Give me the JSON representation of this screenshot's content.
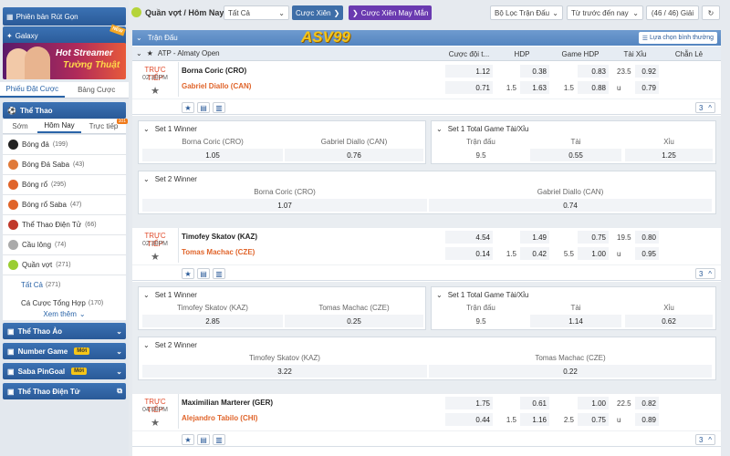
{
  "sidebar": {
    "top_button": "Phiên bản Rút Gọn",
    "galaxy": "Galaxy",
    "new_tag": "NEW",
    "banner_line1": "Hot Streamer",
    "banner_line2": "Tường Thuật",
    "tabs": [
      "Phiếu Đặt Cược",
      "Bảng Cược"
    ],
    "sports_header": "Thể Thao",
    "sub_tabs": [
      "Sớm",
      "Hôm Nay",
      "Trực tiếp"
    ],
    "live_badge": "101",
    "sports": [
      {
        "name": "Bóng đá",
        "count": "(199)",
        "color": "#222"
      },
      {
        "name": "Bóng Đá Saba",
        "count": "(43)",
        "color": "#e07a3a"
      },
      {
        "name": "Bóng rổ",
        "count": "(295)",
        "color": "#e0642a"
      },
      {
        "name": "Bóng rổ Saba",
        "count": "(47)",
        "color": "#e0642a"
      },
      {
        "name": "Thể Thao Điện Tử",
        "count": "(66)",
        "color": "#c0392b"
      },
      {
        "name": "Cầu lông",
        "count": "(74)",
        "color": "#888"
      },
      {
        "name": "Quần vợt",
        "count": "(271)",
        "color": "#9acd32"
      }
    ],
    "tennis_sub": [
      {
        "name": "Tất Cả",
        "count": "(271)"
      },
      {
        "name": "Cá Cược Tổng Hợp",
        "count": "(170)"
      }
    ],
    "see_more": "Xem thêm",
    "sections": [
      {
        "label": "Thể Thao Ảo",
        "tag": ""
      },
      {
        "label": "Number Game",
        "tag": "Mới"
      },
      {
        "label": "Saba PinGoal",
        "tag": "Mới"
      },
      {
        "label": "Thể Thao Điện Tử",
        "tag": ""
      }
    ]
  },
  "topbar": {
    "breadcrumb": "Quần vợt / Hôm Nay",
    "filter_all": "Tất Cả",
    "parlay": "Cược Xiên",
    "lucky_parlay": "Cược Xiên May Mắn",
    "match_filter": "Bộ Lọc Trận Đấu",
    "time_filter": "Từ trước đến nay",
    "count": "(46 / 46) Giải"
  },
  "main": {
    "section_title": "Trận Đấu",
    "logo_text": "ASV99",
    "sort": "Lựa chọn bình thường",
    "league": "ATP - Almaty Open",
    "columns": [
      "Cược đội t...",
      "HDP",
      "Game HDP",
      "Tài Xỉu",
      "Chẵn Lẻ"
    ]
  },
  "matches": [
    {
      "live": "TRỰC TIẾP",
      "time": "02:30PM",
      "team_a": "Borna Coric (CRO)",
      "team_b": "Gabriel Diallo (CAN)",
      "row1": {
        "ml": "1.12",
        "hdp_l": "",
        "hdp": "0.38",
        "ghdp_l": "",
        "ghdp": "0.83",
        "ou_l": "23.5",
        "ou": "0.92"
      },
      "row2": {
        "ml": "0.71",
        "hdp_l": "1.5",
        "hdp": "1.63",
        "ghdp_l": "1.5",
        "ghdp": "0.88",
        "ou_l": "u",
        "ou": "0.79"
      },
      "more": "3",
      "set1": {
        "title": "Set 1 Winner",
        "a": "Borna Coric (CRO)",
        "b": "Gabriel Diallo (CAN)",
        "va": "1.05",
        "vb": "0.76"
      },
      "set1ou": {
        "title": "Set 1 Total Game Tài/Xỉu",
        "h1": "Trận đấu",
        "h2": "Tài",
        "h3": "Xỉu",
        "v1": "9.5",
        "v2": "0.55",
        "v3": "1.25"
      },
      "set2": {
        "title": "Set 2 Winner",
        "a": "Borna Coric (CRO)",
        "b": "Gabriel Diallo (CAN)",
        "va": "1.07",
        "vb": "0.74"
      }
    },
    {
      "live": "TRỰC TIẾP",
      "time": "02:30PM",
      "team_a": "Timofey Skatov (KAZ)",
      "team_b": "Tomas Machac (CZE)",
      "row1": {
        "ml": "4.54",
        "hdp_l": "",
        "hdp": "1.49",
        "ghdp_l": "",
        "ghdp": "0.75",
        "ou_l": "19.5",
        "ou": "0.80"
      },
      "row2": {
        "ml": "0.14",
        "hdp_l": "1.5",
        "hdp": "0.42",
        "ghdp_l": "5.5",
        "ghdp": "1.00",
        "ou_l": "u",
        "ou": "0.95"
      },
      "more": "3",
      "set1": {
        "title": "Set 1 Winner",
        "a": "Timofey Skatov (KAZ)",
        "b": "Tomas Machac (CZE)",
        "va": "2.85",
        "vb": "0.25"
      },
      "set1ou": {
        "title": "Set 1 Total Game Tài/Xỉu",
        "h1": "Trận đấu",
        "h2": "Tài",
        "h3": "Xỉu",
        "v1": "9.5",
        "v2": "1.14",
        "v3": "0.62"
      },
      "set2": {
        "title": "Set 2 Winner",
        "a": "Timofey Skatov (KAZ)",
        "b": "Tomas Machac (CZE)",
        "va": "3.22",
        "vb": "0.22"
      }
    },
    {
      "live": "TRỰC TIẾP",
      "time": "04:00PM",
      "team_a": "Maximilian Marterer (GER)",
      "team_b": "Alejandro Tabilo (CHI)",
      "row1": {
        "ml": "1.75",
        "hdp_l": "",
        "hdp": "0.61",
        "ghdp_l": "",
        "ghdp": "1.00",
        "ou_l": "22.5",
        "ou": "0.82"
      },
      "row2": {
        "ml": "0.44",
        "hdp_l": "1.5",
        "hdp": "1.16",
        "ghdp_l": "2.5",
        "ghdp": "0.75",
        "ou_l": "u",
        "ou": "0.89"
      },
      "more": "3"
    }
  ]
}
